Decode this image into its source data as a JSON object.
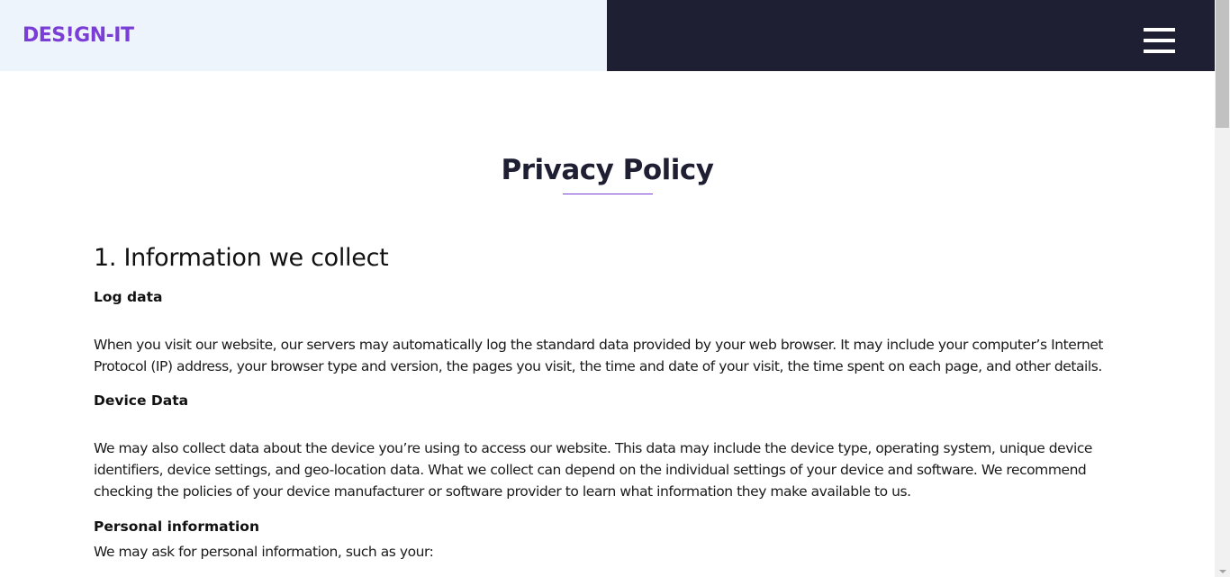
{
  "header": {
    "logo_text": "DES!GN-IT",
    "menu_icon": "hamburger-menu-icon",
    "colors": {
      "left_bg": "#eef4fc",
      "right_bg": "#1e1f32",
      "logo": "#7a3ed6"
    }
  },
  "page": {
    "title": "Privacy Policy",
    "accent_color": "#7a3ed6"
  },
  "sections": [
    {
      "heading": "1. Information we collect",
      "subsections": [
        {
          "heading": "Log data",
          "text": "When you visit our website, our servers may automatically log the standard data provided by your web browser. It may include your computer’s Internet Protocol (IP) address, your browser type and version, the pages you visit, the time and date of your visit, the time spent on each page, and other details."
        },
        {
          "heading": "Device Data",
          "text": "We may also collect data about the device you’re using to access our website. This data may include the device type, operating system, unique device identifiers, device settings, and geo-location data. What we collect can depend on the individual settings of your device and software. We recommend checking the policies of your device manufacturer or software provider to learn what information they make available to us."
        },
        {
          "heading": "Personal information",
          "text": "We may ask for personal information, such as your:"
        }
      ]
    }
  ]
}
